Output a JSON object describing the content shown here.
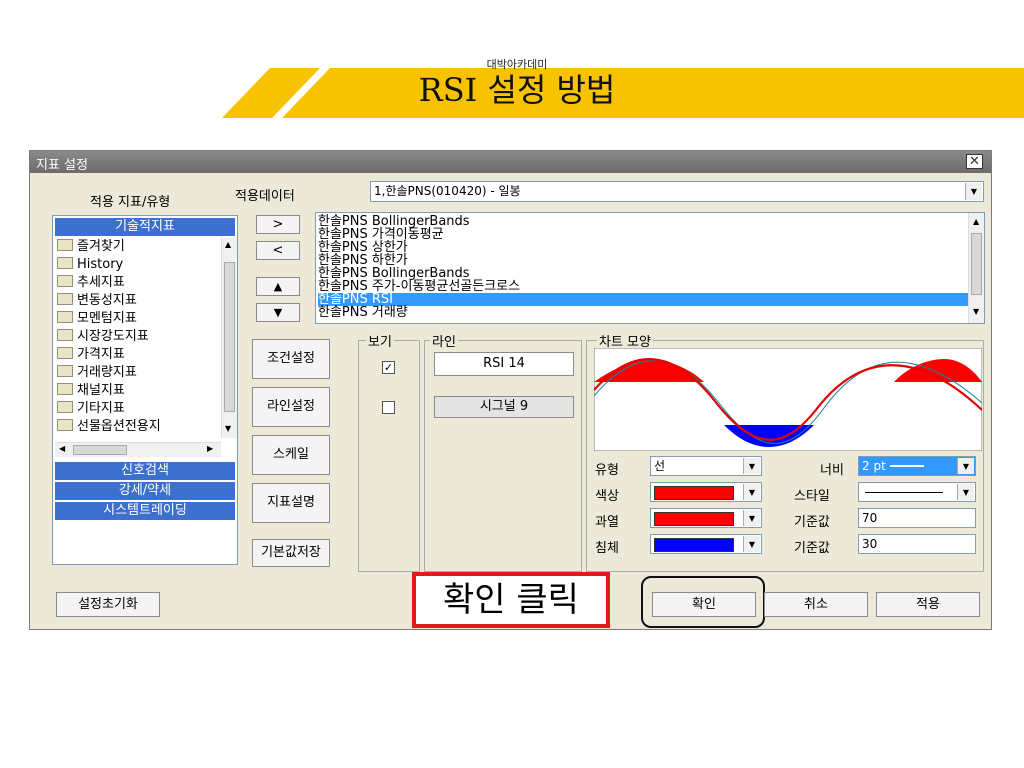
{
  "header": {
    "subtitle": "대박아카데미",
    "title": "RSI 설정 방법"
  },
  "dialog": {
    "title": "지표 설정",
    "close_icon": "close-icon",
    "left_panel": {
      "label": "적용 지표/유형",
      "category_top": "기술적지표",
      "items": [
        "즐겨찾기",
        "History",
        "추세지표",
        "변동성지표",
        "모멘텀지표",
        "시장강도지표",
        "가격지표",
        "거래량지표",
        "채널지표",
        "기타지표",
        "선물옵션전용지"
      ],
      "categories_bottom": [
        "신호검색",
        "강세/약세",
        "시스템트레이딩"
      ]
    },
    "data_select": {
      "label": "적용데이터",
      "value": "1,한솔PNS(010420) - 일봉"
    },
    "move_buttons": [
      ">",
      "<",
      "▲",
      "▼"
    ],
    "indicators": [
      "한솔PNS BollingerBands",
      "한솔PNS 가격이동평균",
      "한솔PNS 상한가",
      "한솔PNS 하한가",
      "한솔PNS BollingerBands",
      "한솔PNS 주가-이동평균선골든크로스",
      "한솔PNS RSI",
      "한솔PNS 거래량"
    ],
    "selected_indicator_index": 6,
    "side_buttons": [
      "조건설정",
      "라인설정",
      "스케일",
      "지표설명",
      "기본값저장"
    ],
    "view_group": {
      "label": "보기",
      "checks": [
        true,
        false
      ]
    },
    "line_group": {
      "label": "라인",
      "lines": [
        "RSI 14",
        "시그널 9"
      ]
    },
    "chart_group": {
      "label": "차트 모양",
      "type_label": "유형",
      "type_value": "선",
      "width_label": "너비",
      "width_value": "2 pt",
      "color_label": "색상",
      "color_value": "#ff0000",
      "style_label": "스타일",
      "overbought_label": "과열",
      "overbought_color": "#ff0000",
      "oversold_label": "침체",
      "oversold_color": "#0000ff",
      "base1_label": "기준값",
      "base1_value": "70",
      "base2_label": "기준값",
      "base2_value": "30"
    },
    "reset_button": "설정초기화",
    "confirm_note": "확인 클릭",
    "ok_button": "확인",
    "cancel_button": "취소",
    "apply_button": "적용"
  },
  "colors": {
    "banner_yellow": "#f7c300",
    "select_blue": "#3399ff",
    "category_blue": "#3c6fce",
    "note_border": "#e11b1b"
  }
}
